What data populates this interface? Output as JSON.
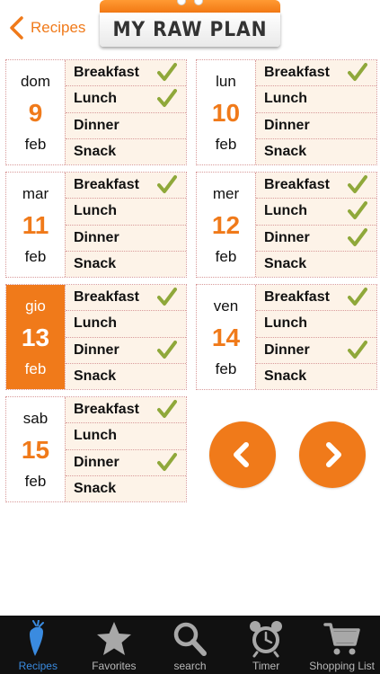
{
  "header": {
    "back_label": "Recipes",
    "title": "MY RAW PLAN"
  },
  "meal_labels": [
    "Breakfast",
    "Lunch",
    "Dinner",
    "Snack"
  ],
  "days": [
    {
      "name": "dom",
      "number": "9",
      "month": "feb",
      "selected": false,
      "checks": [
        true,
        true,
        false,
        false
      ]
    },
    {
      "name": "lun",
      "number": "10",
      "month": "feb",
      "selected": false,
      "checks": [
        true,
        false,
        false,
        false
      ]
    },
    {
      "name": "mar",
      "number": "11",
      "month": "feb",
      "selected": false,
      "checks": [
        true,
        false,
        false,
        false
      ]
    },
    {
      "name": "mer",
      "number": "12",
      "month": "feb",
      "selected": false,
      "checks": [
        true,
        true,
        true,
        false
      ]
    },
    {
      "name": "gio",
      "number": "13",
      "month": "feb",
      "selected": true,
      "checks": [
        true,
        false,
        true,
        false
      ]
    },
    {
      "name": "ven",
      "number": "14",
      "month": "feb",
      "selected": false,
      "checks": [
        true,
        false,
        true,
        false
      ]
    },
    {
      "name": "sab",
      "number": "15",
      "month": "feb",
      "selected": false,
      "checks": [
        true,
        false,
        true,
        false
      ]
    }
  ],
  "tabs": [
    {
      "label": "Recipes",
      "icon": "carrot-icon",
      "active": true
    },
    {
      "label": "Favorites",
      "icon": "star-icon",
      "active": false
    },
    {
      "label": "search",
      "icon": "search-icon",
      "active": false
    },
    {
      "label": "Timer",
      "icon": "alarm-clock-icon",
      "active": false
    },
    {
      "label": "Shopping List",
      "icon": "cart-icon",
      "active": false
    }
  ],
  "colors": {
    "accent": "#f07a1a",
    "check": "#8fa83a",
    "meal_bg": "#fdf3e8",
    "tab_active": "#3a8be0",
    "tab_bar": "#111111"
  }
}
